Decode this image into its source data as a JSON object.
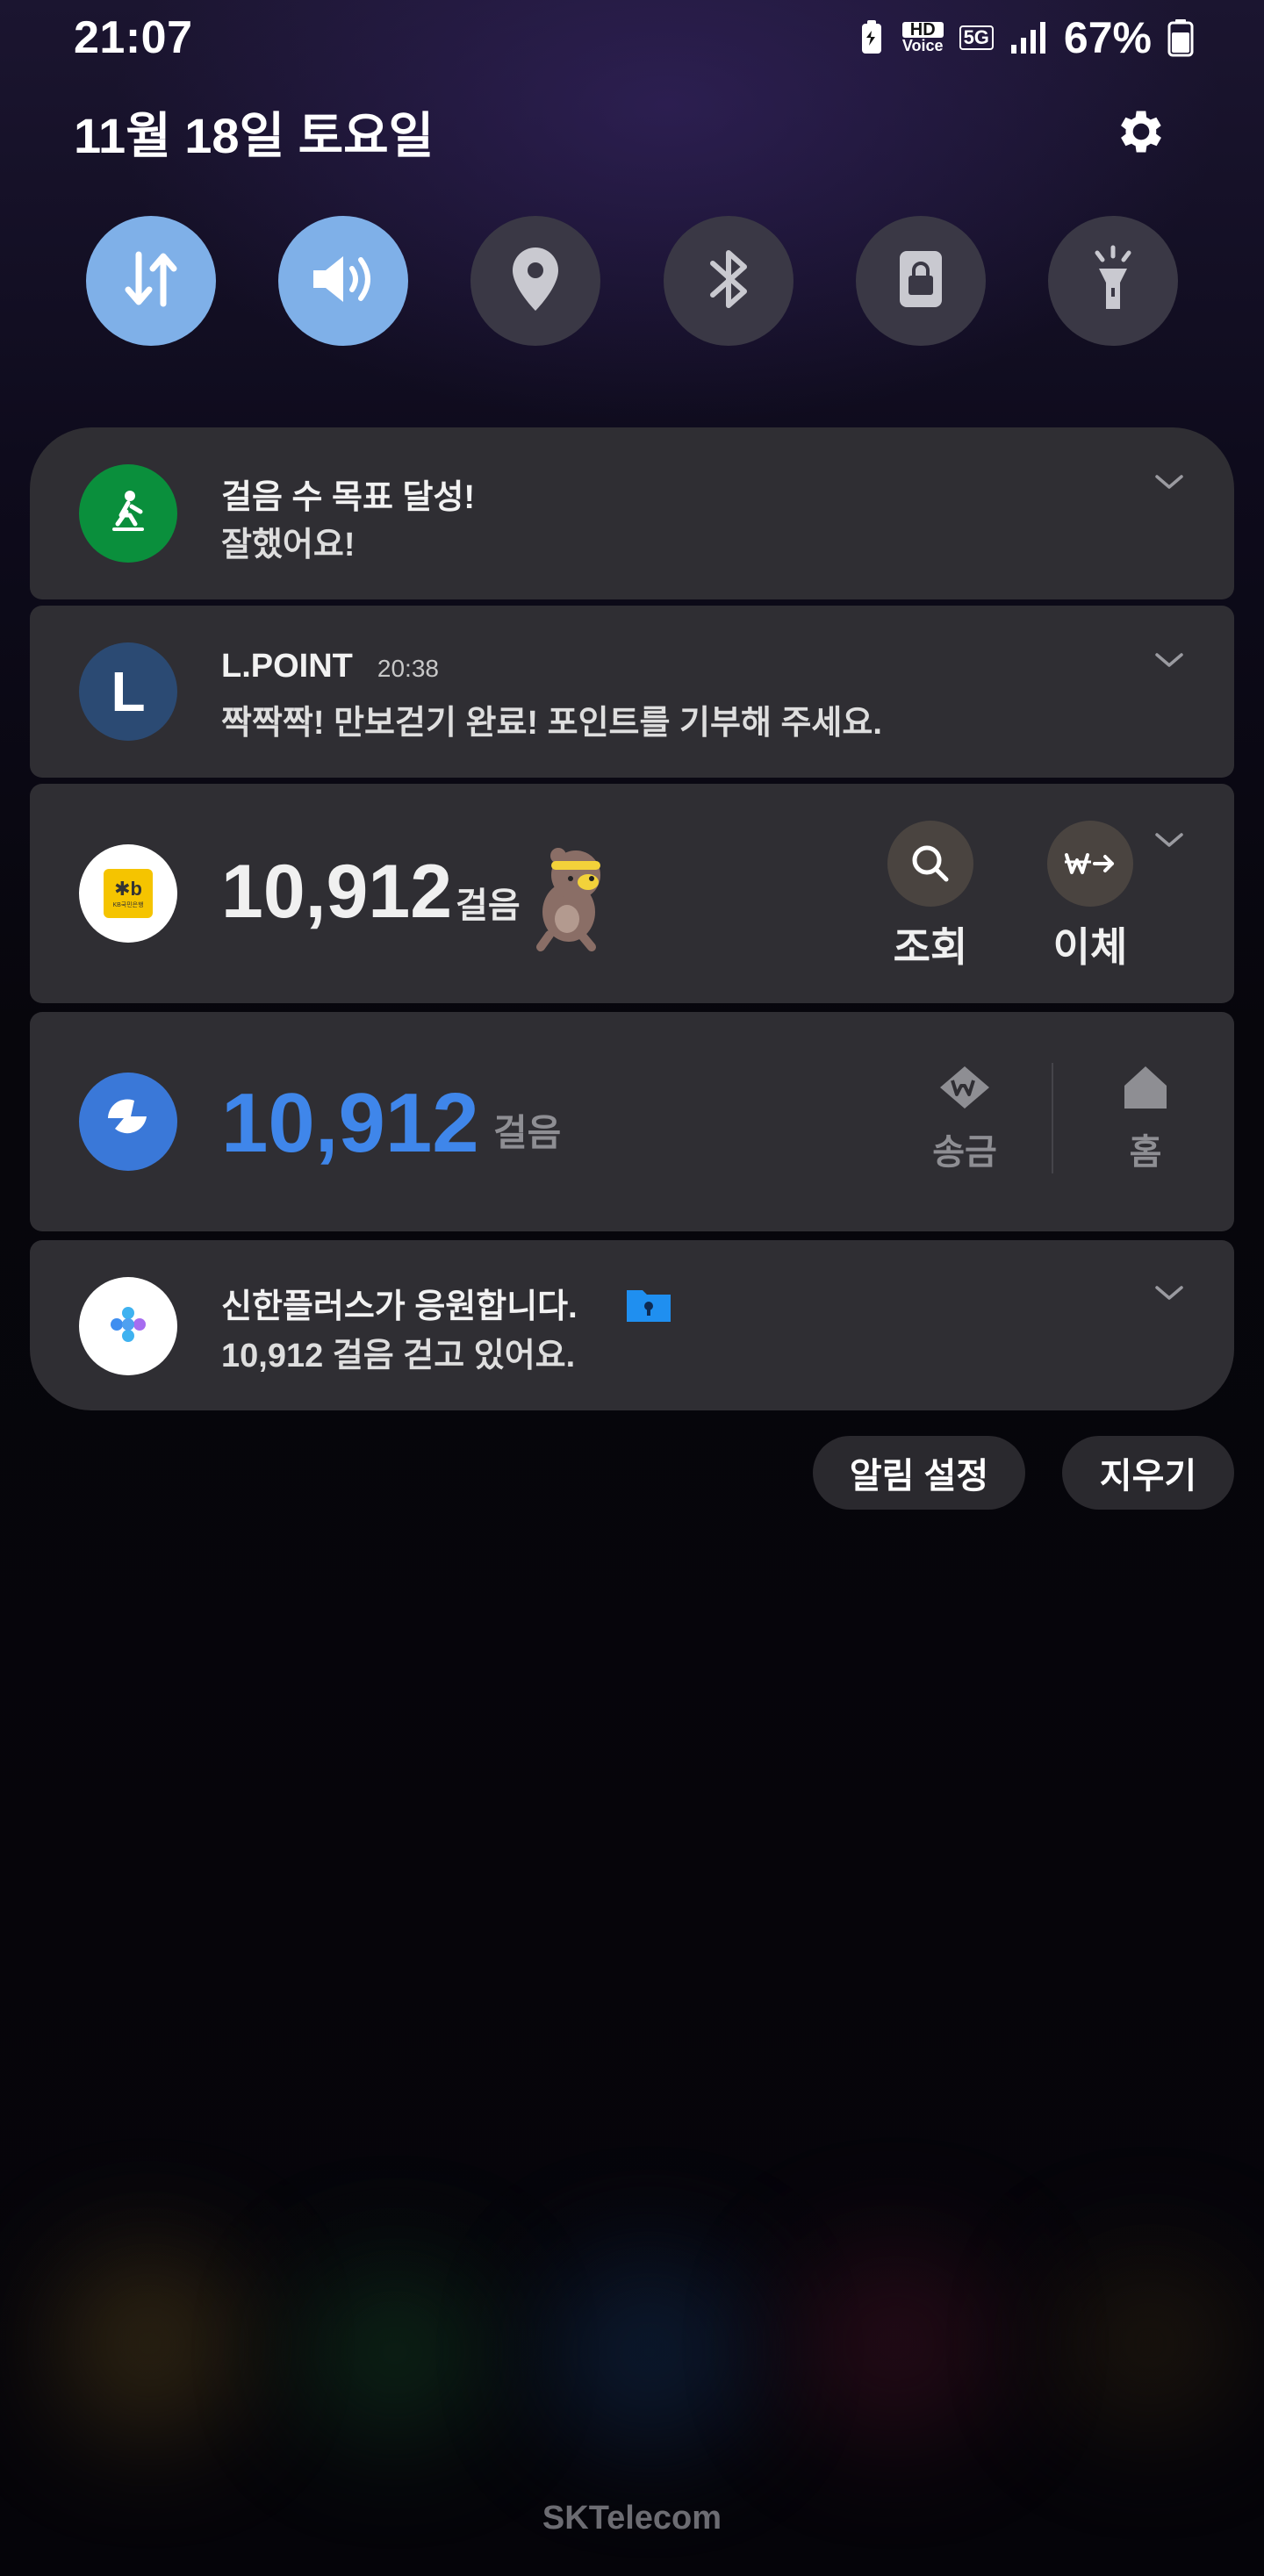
{
  "status_bar": {
    "time": "21:07",
    "battery_percent": "67%",
    "hd_top": "HD",
    "hd_bottom": "Voice",
    "network": "5G"
  },
  "header": {
    "date": "11월 18일 토요일"
  },
  "quick_settings": [
    {
      "name": "mobile-data",
      "icon": "arrows-up-down-icon",
      "active": true
    },
    {
      "name": "sound",
      "icon": "speaker-icon",
      "active": true
    },
    {
      "name": "location",
      "icon": "location-pin-icon",
      "active": false
    },
    {
      "name": "bluetooth",
      "icon": "bluetooth-icon",
      "active": false
    },
    {
      "name": "screen-lock",
      "icon": "lock-icon",
      "active": false
    },
    {
      "name": "flashlight",
      "icon": "flashlight-icon",
      "active": false
    }
  ],
  "notifications": {
    "samsung_health": {
      "title": "걸음 수 목표 달성!",
      "body": "잘했어요!",
      "icon": "walking-person-icon",
      "color": "#0a8f3c"
    },
    "lpoint": {
      "app": "L.POINT",
      "time": "20:38",
      "body": "짝짝짝! 만보걷기 완료! 포인트를 기부해 주세요.",
      "avatar_letter": "L",
      "color": "#2b4a73"
    },
    "kb": {
      "steps": "10,912",
      "unit": "걸음",
      "actions": [
        "조회",
        "이체"
      ],
      "logo_text": "KB국민은행"
    },
    "toss": {
      "steps": "10,912",
      "unit": "걸음",
      "actions": [
        "송금",
        "홈"
      ],
      "color": "#3f86ea"
    },
    "shinhan": {
      "title": "신한플러스가 응원합니다.",
      "body": "10,912 걸음 걷고 있어요."
    }
  },
  "footer_buttons": {
    "settings": "알림 설정",
    "clear": "지우기"
  },
  "carrier": "SKTelecom"
}
